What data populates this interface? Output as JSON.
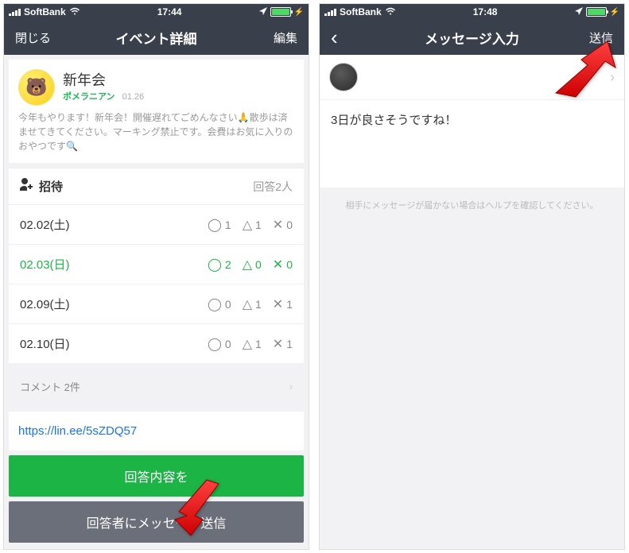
{
  "left": {
    "status": {
      "carrier": "SoftBank",
      "time": "17:44"
    },
    "nav": {
      "close": "閉じる",
      "title": "イベント詳細",
      "edit": "編集"
    },
    "event": {
      "title": "新年会",
      "location": "ポメラニアン",
      "date": "01.26",
      "desc": "今年もやります！新年会！開催遅れてごめんなさい🙏散歩は済ませてきてください。マーキング禁止です。会費はお気に入りのおやつです🔍"
    },
    "invite": {
      "label": "招待",
      "count": "回答2人"
    },
    "rows": [
      {
        "date": "02.02(土)",
        "yes": "1",
        "maybe": "1",
        "no": "0",
        "hl": false
      },
      {
        "date": "02.03(日)",
        "yes": "2",
        "maybe": "0",
        "no": "0",
        "hl": true
      },
      {
        "date": "02.09(土)",
        "yes": "0",
        "maybe": "1",
        "no": "1",
        "hl": false
      },
      {
        "date": "02.10(日)",
        "yes": "0",
        "maybe": "1",
        "no": "1",
        "hl": false
      }
    ],
    "comments": "コメント 2件",
    "link": "https://lin.ee/5sZDQ57",
    "btn1": "回答内容を",
    "btn2": "回答者にメッセージ送信"
  },
  "right": {
    "status": {
      "carrier": "SoftBank",
      "time": "17:48"
    },
    "nav": {
      "title": "メッセージ入力",
      "send": "送信"
    },
    "message": "3日が良さそうですね！",
    "help": "相手にメッセージが届かない場合はヘルプを確認してください。"
  }
}
